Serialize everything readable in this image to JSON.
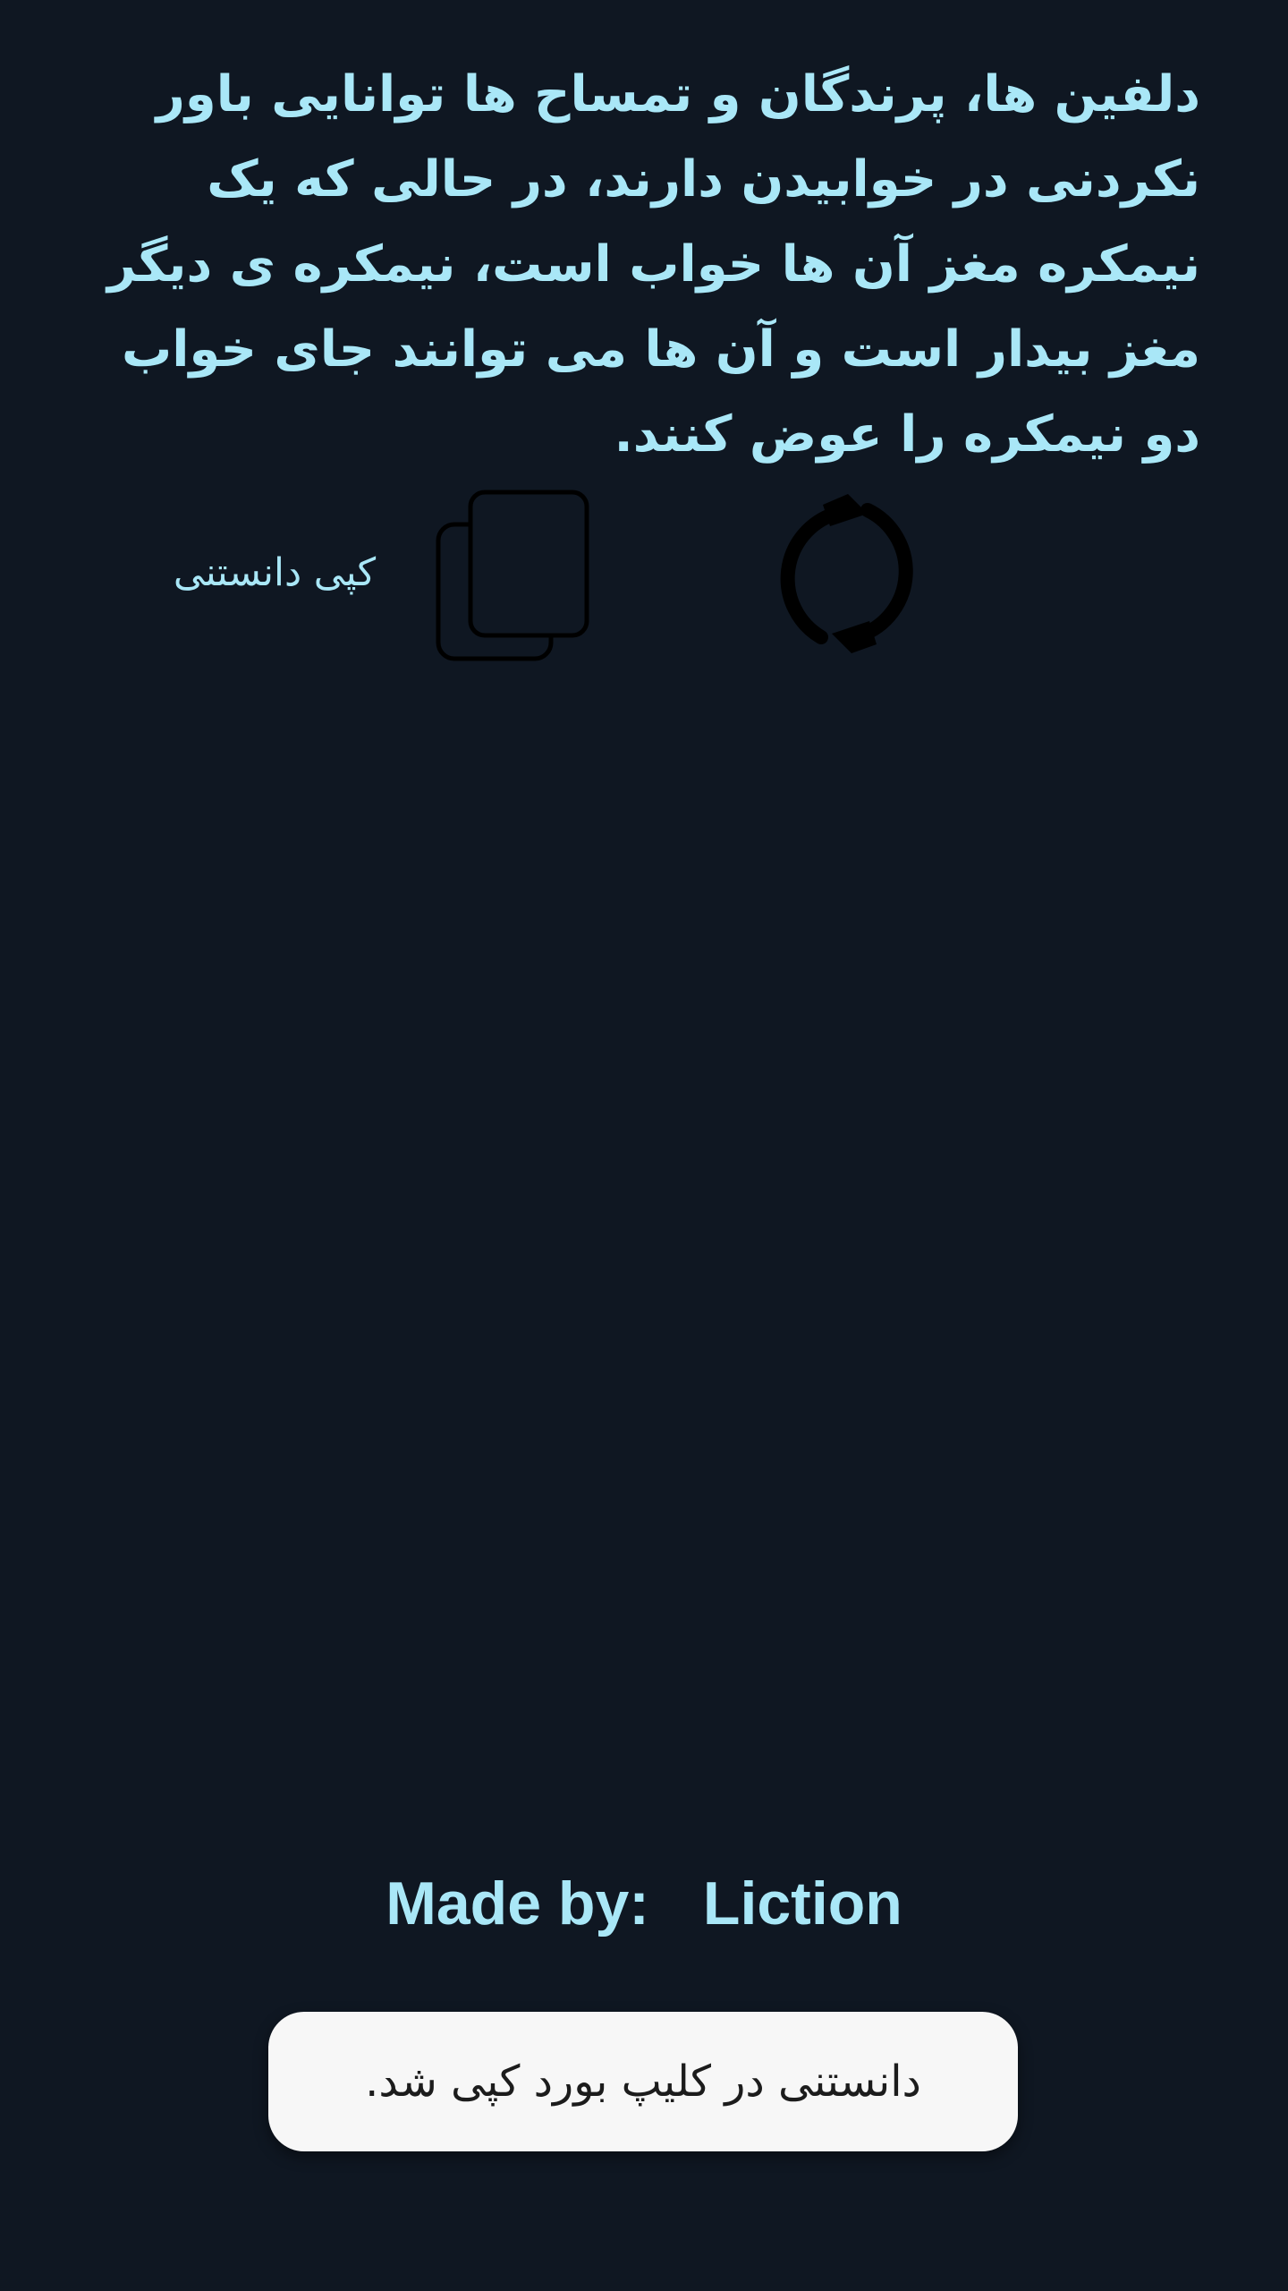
{
  "fact": {
    "text": "دلفین ها، پرندگان و تمساح ها توانایی باور نکردنی در خوابیدن دارند، در حالی که یک نیمکره مغز آن ها خواب است، نیمکره ی دیگر مغز بیدار است و آن ها می توانند جای خواب دو نیمکره را عوض کنند."
  },
  "actions": {
    "copy_label": "کپی دانستنی",
    "copy_icon": "copy-icon",
    "refresh_icon": "refresh-icon"
  },
  "credits": {
    "made_by_label": "Made by:",
    "author": "Liction"
  },
  "toast": {
    "message": "دانستنی در کلیپ بورد کپی شد."
  },
  "colors": {
    "background": "#0F1722",
    "accent_text": "#A9E7F7",
    "toast_background": "#F7F7F7",
    "icon": "#000000"
  }
}
